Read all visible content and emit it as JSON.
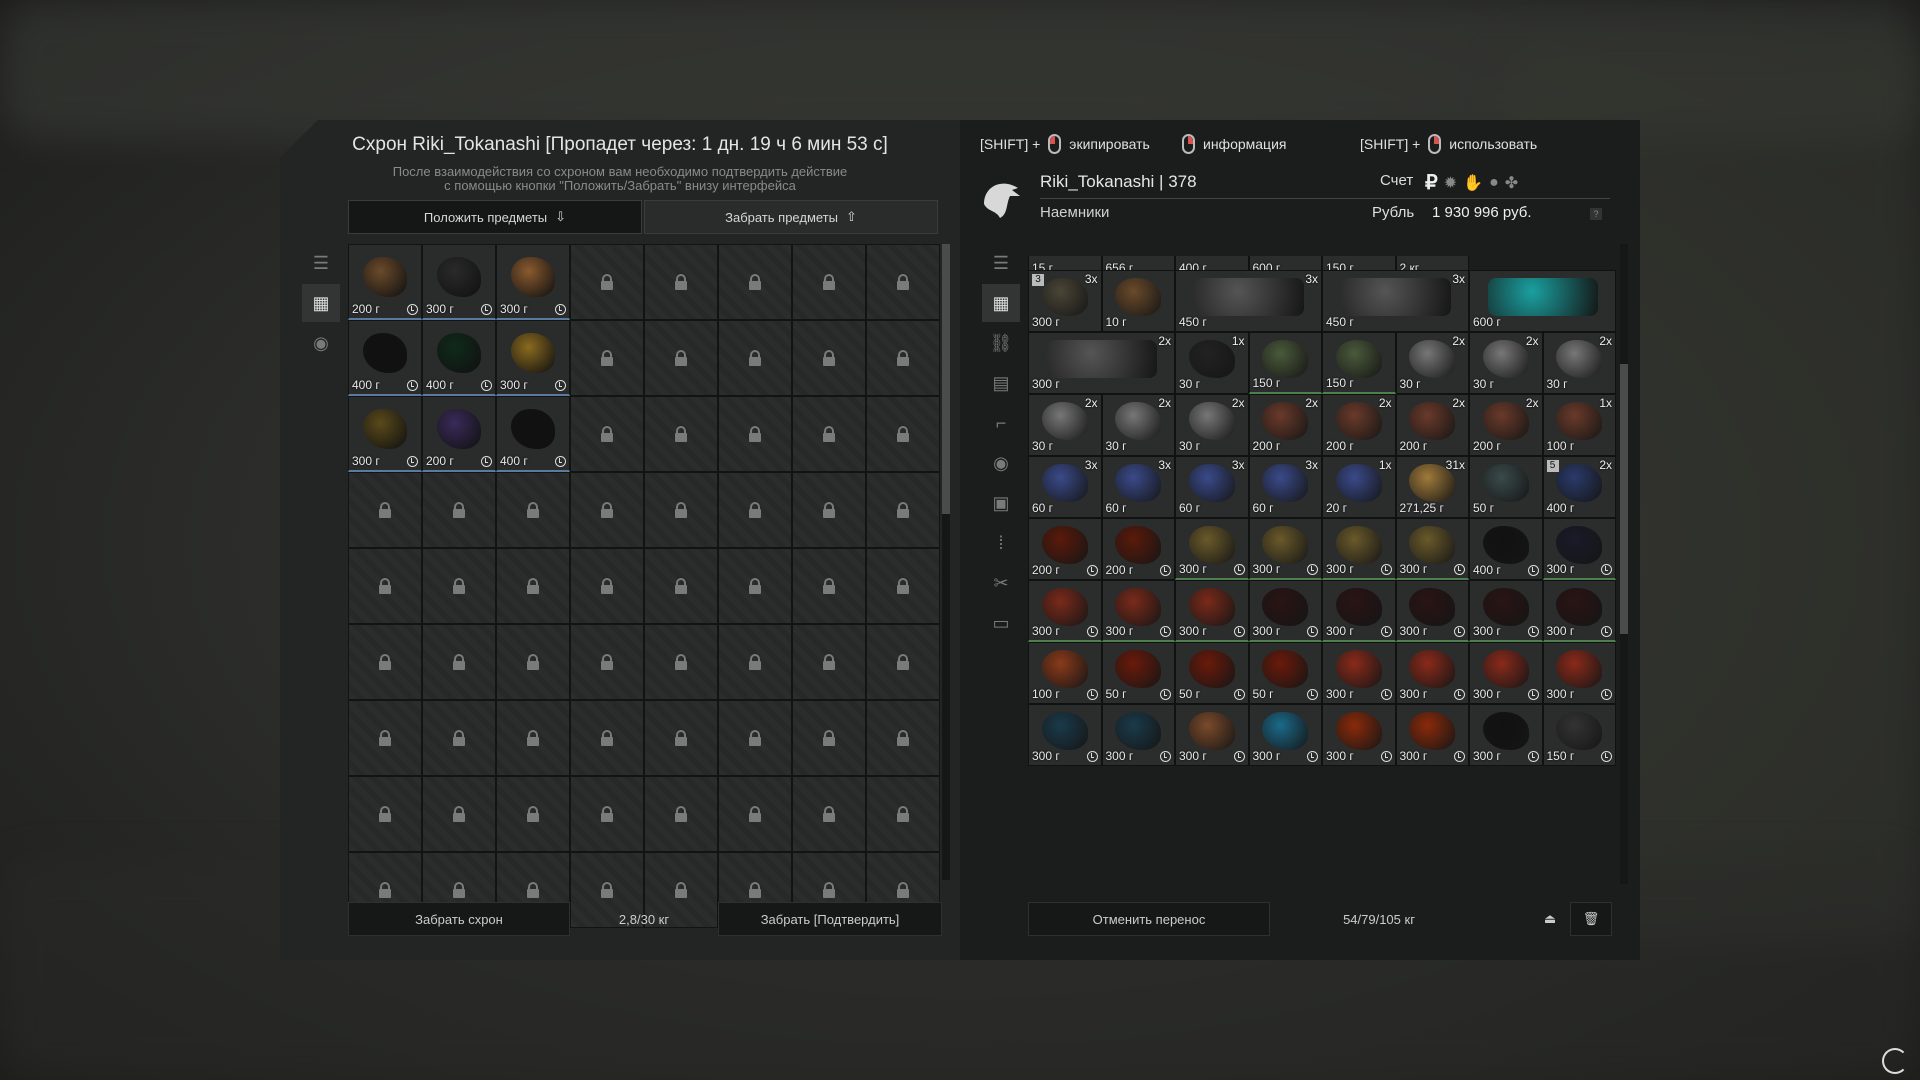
{
  "stash": {
    "title": "Схрон Riki_Tokanashi [Пропадет через: 1 дн. 19 ч 6 мин 53 с]",
    "note_line1": "После взаимодействия со схроном вам необходимо подтвердить действие",
    "note_line2": "с помощью кнопки \"Положить/Забрать\" внизу интерфейса",
    "put_label": "Положить предметы",
    "take_label": "Забрать предметы",
    "items": [
      {
        "price": "200 г",
        "color": "#6b4a2a"
      },
      {
        "price": "300 г",
        "color": "#2a2a2a"
      },
      {
        "price": "300 г",
        "color": "#8a5a2e"
      },
      {
        "price": "400 г",
        "color": "#111111"
      },
      {
        "price": "400 г",
        "color": "#0f2a1a"
      },
      {
        "price": "300 г",
        "color": "#8a6a1e"
      },
      {
        "price": "300 г",
        "color": "#5a4a1a"
      },
      {
        "price": "200 г",
        "color": "#3a2a5a"
      },
      {
        "price": "400 г",
        "color": "#111111"
      }
    ],
    "locked_count": 55,
    "footer_take": "Забрать схрон",
    "footer_weight": "2,8/30 кг",
    "footer_confirm": "Забрать [Подтвердить]"
  },
  "hints": [
    {
      "prefix": "[SHIFT] +",
      "mouse": "left",
      "label": "экипировать"
    },
    {
      "prefix": "",
      "mouse": "right",
      "label": "информация"
    },
    {
      "prefix": "[SHIFT] +",
      "mouse": "right",
      "label": "использовать"
    }
  ],
  "player": {
    "name": "Riki_Tokanashi | 378",
    "faction": "Наемники",
    "account_label": "Счет",
    "currency_label": "Рубль",
    "balance": "1 930 996 руб.",
    "currency_symbol": "₽"
  },
  "inventory": {
    "top_partial": [
      "15 г",
      "656 г",
      "400 г",
      "600 г",
      "150 г",
      "2 кг"
    ],
    "rows": [
      [
        {
          "p": "300 г",
          "c": "3x",
          "b": "3",
          "col": "#4a4536",
          "w": 1
        },
        {
          "p": "10 г",
          "col": "#6a4a2a",
          "w": 1
        },
        {
          "p": "450 г",
          "c": "3x",
          "col": "#555",
          "w": 2
        },
        {
          "p": "450 г",
          "c": "3x",
          "col": "#555",
          "w": 2
        },
        {
          "p": "600 г",
          "col": "#1aa0a0",
          "w": 2
        }
      ],
      [
        {
          "p": "300 г",
          "c": "2x",
          "col": "#555",
          "w": 2
        },
        {
          "p": "30 г",
          "c": "1x",
          "col": "#222",
          "w": 1
        },
        {
          "p": "150 г",
          "col": "#4a5a3a",
          "w": 1,
          "g": true
        },
        {
          "p": "150 г",
          "col": "#4a5a3a",
          "w": 1,
          "g": true
        },
        {
          "p": "30 г",
          "c": "2x",
          "col": "#777",
          "w": 1
        },
        {
          "p": "30 г",
          "c": "2x",
          "col": "#777",
          "w": 1
        },
        {
          "p": "30 г",
          "c": "2x",
          "col": "#777",
          "w": 1
        }
      ],
      [
        {
          "p": "30 г",
          "c": "2x",
          "col": "#777",
          "w": 1
        },
        {
          "p": "30 г",
          "c": "2x",
          "col": "#777",
          "w": 1
        },
        {
          "p": "30 г",
          "c": "2x",
          "col": "#777",
          "w": 1
        },
        {
          "p": "200 г",
          "c": "2x",
          "col": "#6a3a2a",
          "w": 1
        },
        {
          "p": "200 г",
          "c": "2x",
          "col": "#6a3a2a",
          "w": 1
        },
        {
          "p": "200 г",
          "c": "2x",
          "col": "#6a3a2a",
          "w": 1
        },
        {
          "p": "200 г",
          "c": "2x",
          "col": "#6a3a2a",
          "w": 1
        },
        {
          "p": "100 г",
          "c": "1x",
          "col": "#6a3a2a",
          "w": 1
        }
      ],
      [
        {
          "p": "60 г",
          "c": "3x",
          "col": "#3a4a8a",
          "w": 1
        },
        {
          "p": "60 г",
          "c": "3x",
          "col": "#3a4a8a",
          "w": 1
        },
        {
          "p": "60 г",
          "c": "3x",
          "col": "#3a4a8a",
          "w": 1
        },
        {
          "p": "60 г",
          "c": "3x",
          "col": "#3a4a8a",
          "w": 1
        },
        {
          "p": "20 г",
          "c": "1x",
          "col": "#3a4a8a",
          "w": 1
        },
        {
          "p": "271,25 г",
          "c": "31x",
          "col": "#a07a3a",
          "w": 1
        },
        {
          "p": "50 г",
          "col": "#3a4a4a",
          "w": 1
        },
        {
          "p": "400 г",
          "c": "2x",
          "b": "5",
          "col": "#2a3a6a",
          "w": 1
        }
      ],
      [
        {
          "p": "200 г",
          "col": "#5a1a0a",
          "w": 1,
          "t": 1
        },
        {
          "p": "200 г",
          "col": "#5a1a0a",
          "w": 1,
          "t": 1
        },
        {
          "p": "300 г",
          "col": "#6a5a2a",
          "w": 1,
          "t": 1,
          "g": true
        },
        {
          "p": "300 г",
          "col": "#6a5a2a",
          "w": 1,
          "t": 1,
          "g": true
        },
        {
          "p": "300 г",
          "col": "#6a5a2a",
          "w": 1,
          "t": 1,
          "g": true
        },
        {
          "p": "300 г",
          "col": "#6a5a2a",
          "w": 1,
          "t": 1,
          "g": true
        },
        {
          "p": "400 г",
          "col": "#111",
          "w": 1,
          "t": 1
        },
        {
          "p": "300 г",
          "col": "#1a1a2a",
          "w": 1,
          "t": 1,
          "g": true
        }
      ],
      [
        {
          "p": "300 г",
          "col": "#7a2a1a",
          "w": 1,
          "t": 1,
          "g": true
        },
        {
          "p": "300 г",
          "col": "#7a2a1a",
          "w": 1,
          "t": 1,
          "g": true
        },
        {
          "p": "300 г",
          "col": "#7a2a1a",
          "w": 1,
          "t": 1,
          "g": true
        },
        {
          "p": "300 г",
          "col": "#2a1414",
          "w": 1,
          "t": 1,
          "g": true
        },
        {
          "p": "300 г",
          "col": "#2a1414",
          "w": 1,
          "t": 1,
          "g": true
        },
        {
          "p": "300 г",
          "col": "#2a1414",
          "w": 1,
          "t": 1,
          "g": true
        },
        {
          "p": "300 г",
          "col": "#2a1414",
          "w": 1,
          "t": 1,
          "g": true
        },
        {
          "p": "300 г",
          "col": "#2a1414",
          "w": 1,
          "t": 1,
          "g": true
        }
      ],
      [
        {
          "p": "100 г",
          "col": "#8a3a1a",
          "w": 1,
          "t": 1
        },
        {
          "p": "50 г",
          "col": "#6a1a0a",
          "w": 1,
          "t": 1
        },
        {
          "p": "50 г",
          "col": "#6a1a0a",
          "w": 1,
          "t": 1
        },
        {
          "p": "50 г",
          "col": "#6a1a0a",
          "w": 1,
          "t": 1
        },
        {
          "p": "300 г",
          "col": "#8a2a1a",
          "w": 1,
          "t": 1
        },
        {
          "p": "300 г",
          "col": "#8a2a1a",
          "w": 1,
          "t": 1
        },
        {
          "p": "300 г",
          "col": "#8a2a1a",
          "w": 1,
          "t": 1
        },
        {
          "p": "300 г",
          "col": "#8a2a1a",
          "w": 1,
          "t": 1
        }
      ],
      [
        {
          "p": "300 г",
          "col": "#1a3a4a",
          "w": 1,
          "t": 1
        },
        {
          "p": "300 г",
          "col": "#1a3a4a",
          "w": 1,
          "t": 1
        },
        {
          "p": "300 г",
          "col": "#7a4a2a",
          "w": 1,
          "t": 1
        },
        {
          "p": "300 г",
          "col": "#1a6a8a",
          "w": 1,
          "t": 1
        },
        {
          "p": "300 г",
          "col": "#8a2a0a",
          "w": 1,
          "t": 1
        },
        {
          "p": "300 г",
          "col": "#8a2a0a",
          "w": 1,
          "t": 1
        },
        {
          "p": "300 г",
          "col": "#111",
          "w": 1,
          "t": 1
        },
        {
          "p": "150 г",
          "col": "#333",
          "w": 1,
          "t": 1
        }
      ]
    ],
    "cancel_label": "Отменить перенос",
    "weight": "54/79/105 кг"
  }
}
